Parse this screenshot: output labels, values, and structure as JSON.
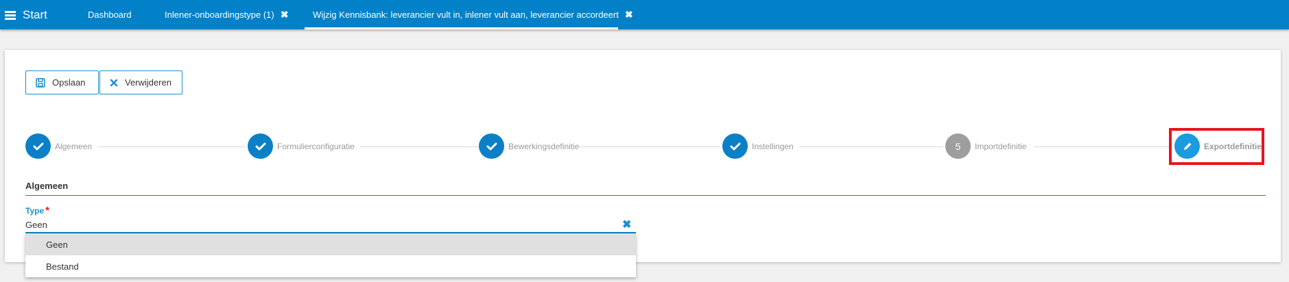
{
  "topbar": {
    "start_label": "Start",
    "tabs": [
      {
        "label": "Dashboard"
      },
      {
        "label": "Inlener-onboardingstype (1)",
        "close": "✖"
      },
      {
        "label": "Wijzig Kennisbank: leverancier vult in, inlener vult aan, leverancier accordeert",
        "close": "✖"
      }
    ],
    "color": "#0281c8"
  },
  "toolbar": {
    "save_label": "Opslaan",
    "delete_label": "Verwijderen"
  },
  "stepper": {
    "steps": [
      {
        "label": "Algemeen",
        "status": "done"
      },
      {
        "label": "Formulierconfiguratie",
        "status": "done"
      },
      {
        "label": "Bewerkingsdefinitie",
        "status": "done"
      },
      {
        "label": "Instellingen",
        "status": "done"
      },
      {
        "label": "Importdefinitie",
        "status": "pending",
        "number": "5"
      },
      {
        "label": "Exportdefinitie",
        "status": "active"
      }
    ],
    "highlight_color": "#e8141c"
  },
  "section": {
    "title": "Algemeen"
  },
  "field": {
    "label": "Type",
    "required_mark": "*",
    "value": "Geen",
    "clear": "✖"
  },
  "dropdown": {
    "options": [
      {
        "label": "Geen",
        "selected": true
      },
      {
        "label": "Bestand",
        "selected": false
      }
    ]
  }
}
